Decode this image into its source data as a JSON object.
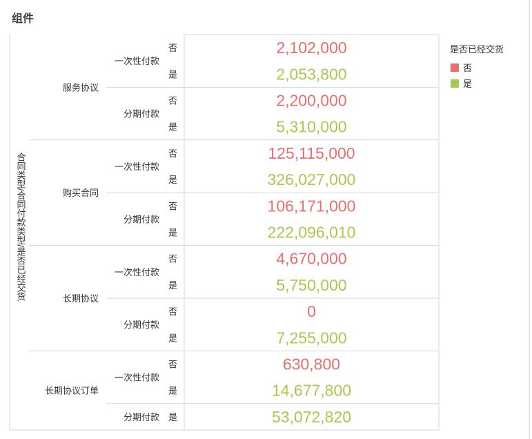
{
  "panel": {
    "title": "组件"
  },
  "colors": {
    "no": "#e96e6e",
    "yes": "#a7c94f",
    "grid": "#d5d5d5",
    "text": "#333333"
  },
  "chart_data": {
    "type": "table",
    "axis_label": "合同类型/合同付款类型/是否已经交货",
    "legend": {
      "title": "是否已经交货",
      "entries": [
        "否",
        "是"
      ]
    },
    "rows": [
      {
        "contract": "服务协议",
        "payment": "一次性付款",
        "delivered": "否",
        "value": 2102000,
        "display": "2,102,000"
      },
      {
        "contract": "服务协议",
        "payment": "一次性付款",
        "delivered": "是",
        "value": 2053800,
        "display": "2,053,800"
      },
      {
        "contract": "服务协议",
        "payment": "分期付款",
        "delivered": "否",
        "value": 2200000,
        "display": "2,200,000"
      },
      {
        "contract": "服务协议",
        "payment": "分期付款",
        "delivered": "是",
        "value": 5310000,
        "display": "5,310,000"
      },
      {
        "contract": "购买合同",
        "payment": "一次性付款",
        "delivered": "否",
        "value": 125115000,
        "display": "125,115,000"
      },
      {
        "contract": "购买合同",
        "payment": "一次性付款",
        "delivered": "是",
        "value": 326027000,
        "display": "326,027,000"
      },
      {
        "contract": "购买合同",
        "payment": "分期付款",
        "delivered": "否",
        "value": 106171000,
        "display": "106,171,000"
      },
      {
        "contract": "购买合同",
        "payment": "分期付款",
        "delivered": "是",
        "value": 222096010,
        "display": "222,096,010"
      },
      {
        "contract": "长期协议",
        "payment": "一次性付款",
        "delivered": "否",
        "value": 4670000,
        "display": "4,670,000"
      },
      {
        "contract": "长期协议",
        "payment": "一次性付款",
        "delivered": "是",
        "value": 5750000,
        "display": "5,750,000"
      },
      {
        "contract": "长期协议",
        "payment": "分期付款",
        "delivered": "否",
        "value": 0,
        "display": "0"
      },
      {
        "contract": "长期协议",
        "payment": "分期付款",
        "delivered": "是",
        "value": 7255000,
        "display": "7,255,000"
      },
      {
        "contract": "长期协议订单",
        "payment": "一次性付款",
        "delivered": "否",
        "value": 630800,
        "display": "630,800"
      },
      {
        "contract": "长期协议订单",
        "payment": "一次性付款",
        "delivered": "是",
        "value": 14677800,
        "display": "14,677,800"
      },
      {
        "contract": "长期协议订单",
        "payment": "分期付款",
        "delivered": "是",
        "value": 53072820,
        "display": "53,072,820"
      }
    ]
  }
}
